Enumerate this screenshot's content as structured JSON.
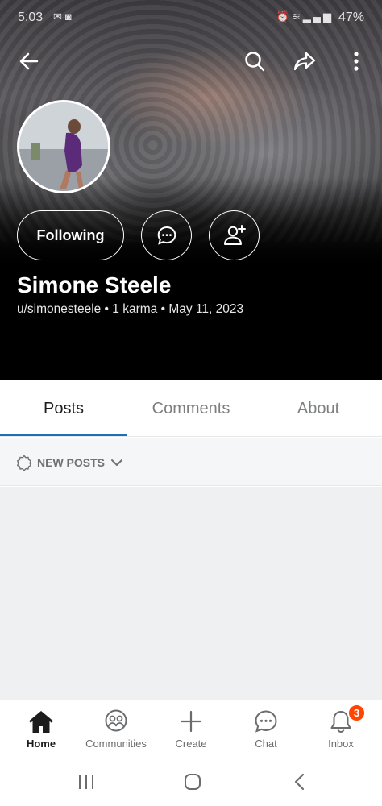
{
  "status_bar": {
    "time": "5:03",
    "left_icons": [
      "mail-icon",
      "instagram-icon"
    ],
    "right_icons": [
      "alarm-icon",
      "vowifi-icon",
      "signal-icon"
    ],
    "battery": "47%"
  },
  "header": {
    "back_icon": "arrow-left-icon",
    "search_icon": "search-icon",
    "share_icon": "share-icon",
    "more_icon": "more-vertical-icon"
  },
  "profile": {
    "follow_label": "Following",
    "display_name": "Simone Steele",
    "meta": "u/simonesteele • 1 karma • May 11, 2023"
  },
  "tabs": [
    {
      "label": "Posts",
      "active": true
    },
    {
      "label": "Comments",
      "active": false
    },
    {
      "label": "About",
      "active": false
    }
  ],
  "sort": {
    "label": "NEW POSTS"
  },
  "bottom_nav": [
    {
      "label": "Home",
      "icon": "home-icon",
      "active": true
    },
    {
      "label": "Communities",
      "icon": "communities-icon",
      "active": false
    },
    {
      "label": "Create",
      "icon": "plus-icon",
      "active": false
    },
    {
      "label": "Chat",
      "icon": "chat-icon",
      "active": false
    },
    {
      "label": "Inbox",
      "icon": "bell-icon",
      "active": false,
      "badge": "3"
    }
  ],
  "colors": {
    "accent": "#1f6fb5",
    "badge": "#ff4500",
    "banner_bg": "#000000"
  }
}
